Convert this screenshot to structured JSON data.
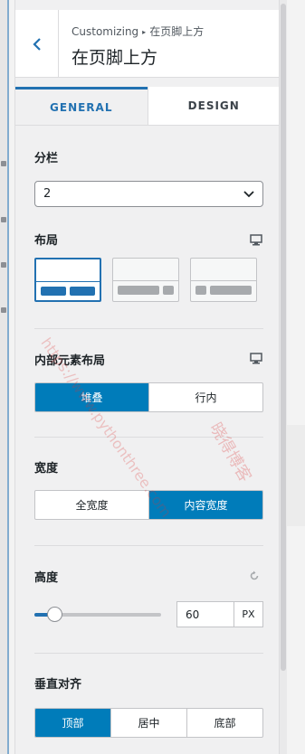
{
  "header": {
    "breadcrumb_root": "Customizing",
    "breadcrumb_current": "在页脚上方",
    "title": "在页脚上方"
  },
  "tabs": [
    {
      "label": "GENERAL",
      "active": true
    },
    {
      "label": "DESIGN",
      "active": false
    }
  ],
  "columns": {
    "label": "分栏",
    "value": "2"
  },
  "layout": {
    "label": "布局",
    "options": [
      "layout-equal",
      "layout-left-wide",
      "layout-right-wide"
    ],
    "selected_index": 0
  },
  "inner_layout": {
    "label": "内部元素布局",
    "options": [
      "堆叠",
      "行内"
    ],
    "selected": "堆叠"
  },
  "width": {
    "label": "宽度",
    "options": [
      "全宽度",
      "内容宽度"
    ],
    "selected": "内容宽度"
  },
  "height": {
    "label": "高度",
    "value": "60",
    "unit": "PX",
    "slider_fraction": 0.16
  },
  "vertical_align": {
    "label": "垂直对齐",
    "options": [
      "顶部",
      "居中",
      "底部"
    ],
    "selected": "顶部"
  },
  "watermark": {
    "url_text": "https://www.pythonthree.com",
    "cn_text": "晓得博客"
  },
  "colors": {
    "accent": "#2271b1",
    "button_active": "#007cba"
  }
}
